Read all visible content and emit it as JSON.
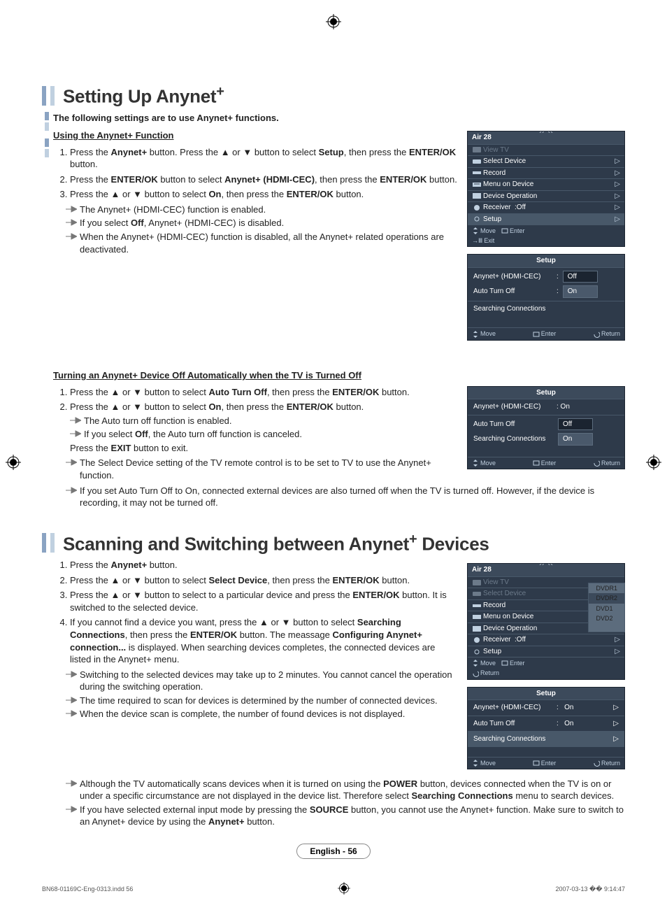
{
  "section1": {
    "title_pre": "Setting Up Anynet",
    "title_plus": "+",
    "intro": "The following settings are to use Anynet+ functions.",
    "sub_a": {
      "heading": "Using the Anynet+ Function",
      "steps": {
        "s1_a": "Press the ",
        "s1_b": "Anynet+",
        "s1_c": " button.\nPress the ▲ or ▼ button to select ",
        "s1_d": "Setup",
        "s1_e": ", then press the ",
        "s1_f": "ENTER/OK",
        "s1_g": " button.",
        "s2_a": "Press the ",
        "s2_b": "ENTER/OK",
        "s2_c": " button to select ",
        "s2_d": "Anynet+ (HDMI-CEC)",
        "s2_e": ", then press the ",
        "s2_f": "ENTER/OK",
        "s2_g": " button.",
        "s3_a": "Press the ▲ or ▼ button to select ",
        "s3_b": "On",
        "s3_c": ", then press the ",
        "s3_d": "ENTER/OK",
        "s3_e": " button."
      },
      "notes": {
        "n1": "The Anynet+ (HDMI-CEC) function is enabled.",
        "n2_a": "If you select ",
        "n2_b": "Off",
        "n2_c": ", Anynet+ (HDMI-CEC) is disabled.",
        "n3": "When the Anynet+ (HDMI-CEC) function is disabled, all the Anynet+ related operations are deactivated."
      }
    },
    "sub_b": {
      "heading": "Turning an Anynet+ Device Off Automatically when the TV is Turned Off",
      "steps": {
        "s1_a": "Press the ▲ or ▼ button to select ",
        "s1_b": "Auto Turn Off",
        "s1_c": ", then press the ",
        "s1_d": "ENTER/OK",
        "s1_e": " button.",
        "s2_a": "Press the ▲ or ▼ button to select ",
        "s2_b": "On",
        "s2_c": ", then press the ",
        "s2_d": "ENTER/OK",
        "s2_e": " button."
      },
      "subnotes": {
        "n1": "The Auto turn off function is enabled.",
        "n2_a": "If you select ",
        "n2_b": "Off",
        "n2_c": ", the Auto turn off function is canceled."
      },
      "exit_a": "Press the ",
      "exit_b": "EXIT",
      "exit_c": " button to exit.",
      "notes": {
        "n1": "The Select Device setting of the TV remote control is to be set to TV to use the Anynet+ function.",
        "n2": "If you set Auto Turn Off to On, connected external devices are also turned off when the TV is turned off. However, if the device is recording, it may not be turned off."
      }
    }
  },
  "section2": {
    "title_pre": "Scanning and Switching between Anynet",
    "title_plus": "+",
    "title_post": " Devices",
    "steps": {
      "s1_a": "Press the ",
      "s1_b": "Anynet+",
      "s1_c": " button.",
      "s2_a": "Press the ▲ or ▼ button to select ",
      "s2_b": "Select Device",
      "s2_c": ", then press the ",
      "s2_d": "ENTER/OK",
      "s2_e": " button.",
      "s3_a": "Press the ▲ or ▼ button to select to a particular device and press the ",
      "s3_b": "ENTER/OK",
      "s3_c": " button.\nIt is switched to the selected device.",
      "s4_a": "If you cannot find a device you want, press the ▲ or ▼ button to select ",
      "s4_b": "Searching Connections",
      "s4_c": ", then press the ",
      "s4_d": "ENTER/OK",
      "s4_e": " button.\nThe meassage ",
      "s4_f": "Configuring Anynet+ connection...",
      "s4_g": " is displayed. When searching devices completes, the connected devices are listed in the Anynet+ menu."
    },
    "notes": {
      "n1": "Switching to the selected devices may take up to 2 minutes. You cannot cancel the operation during the switching operation.",
      "n2": "The time required to scan for devices is determined by the number of connected devices.",
      "n3": "When the device scan is complete, the number of found devices is not displayed.",
      "n4_a": "Although the TV automatically scans devices when it is turned on using the ",
      "n4_b": "POWER",
      "n4_c": " button, devices connected when the TV is on or under a specific circumstance are not displayed in the device list. Therefore select ",
      "n4_d": "Searching Connections",
      "n4_e": " menu to search devices.",
      "n5_a": "If you have selected external input mode by pressing the ",
      "n5_b": "SOURCE",
      "n5_c": " button, you cannot use the Anynet+ function. Make sure to switch to an Anynet+ device by using the ",
      "n5_d": "Anynet+",
      "n5_e": " button."
    }
  },
  "osd": {
    "air": "Air 28",
    "view_tv": "View TV",
    "select_device": "Select Device",
    "record": "Record",
    "menu_on_device": "Menu on Device",
    "device_operation": "Device Operation",
    "receiver": "Receiver",
    "receiver_off": ":Off",
    "setup": "Setup",
    "move": "Move",
    "enter": "Enter",
    "exit": "Exit",
    "return": "Return",
    "anynet_hdmi": "Anynet+ (HDMI-CEC)",
    "auto_turn_off": "Auto Turn Off",
    "searching": "Searching Connections",
    "on": "On",
    "off": "Off",
    "on_colon": ": On",
    "dvdr1": "DVDR1",
    "dvdr2": "DVDR2",
    "dvd1": "DVD1",
    "dvd2": "DVD2"
  },
  "footer": {
    "page_label": "English - 56",
    "doc_id": "BN68-01169C-Eng-0313.indd   56",
    "timestamp": "2007-03-13   �� 9:14:47"
  }
}
